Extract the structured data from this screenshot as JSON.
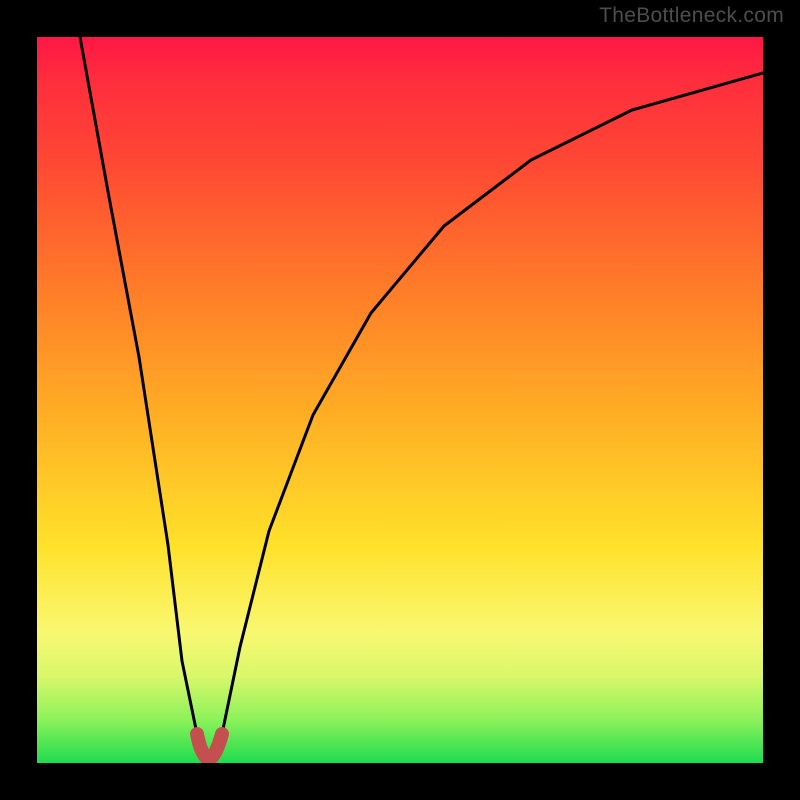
{
  "watermark": {
    "text": "TheBottleneck.com"
  },
  "chart_data": {
    "type": "line",
    "title": "",
    "xlabel": "",
    "ylabel": "",
    "xlim": [
      0,
      100
    ],
    "ylim": [
      0,
      100
    ],
    "grid": false,
    "legend": false,
    "background": {
      "type": "vertical-gradient",
      "stops": [
        {
          "pos": 0,
          "color": "#ff1744"
        },
        {
          "pos": 18,
          "color": "#ff4a33"
        },
        {
          "pos": 52,
          "color": "#ffae24"
        },
        {
          "pos": 82,
          "color": "#f9f871"
        },
        {
          "pos": 100,
          "color": "#1edc4f"
        }
      ]
    },
    "series": [
      {
        "name": "bottleneck-curve",
        "color": "#000000",
        "x": [
          6,
          10,
          14,
          18,
          20,
          22,
          23.5,
          25.5,
          28,
          32,
          38,
          46,
          56,
          68,
          82,
          100
        ],
        "values": [
          100,
          78,
          56,
          30,
          14,
          4,
          0,
          4,
          16,
          32,
          48,
          62,
          74,
          83,
          90,
          95
        ]
      }
    ],
    "highlight": {
      "name": "minimum-marker",
      "xrange": [
        22.5,
        25
      ],
      "yrange": [
        0,
        3
      ],
      "color": "#c54f4f"
    }
  }
}
